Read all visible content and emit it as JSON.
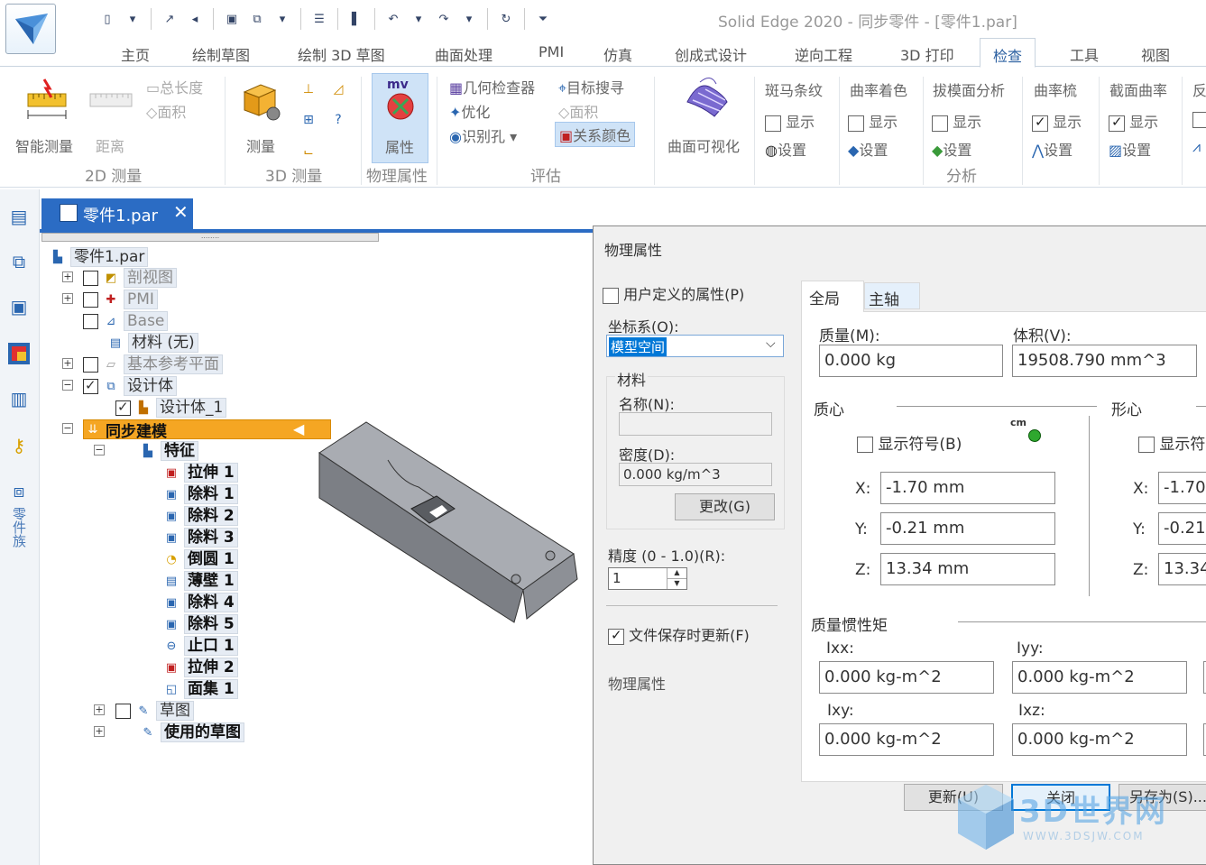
{
  "window": {
    "title": "Solid Edge 2020 - 同步零件 - [零件1.par]"
  },
  "ribbon_tabs": [
    "主页",
    "绘制草图",
    "绘制 3D 草图",
    "曲面处理",
    "PMI",
    "仿真",
    "创成式设计",
    "逆向工程",
    "3D 打印",
    "检查",
    "工具",
    "视图"
  ],
  "active_tab": "检查",
  "ribbon": {
    "smart_measure": "智能测量",
    "distance": "距离",
    "total_length": "总长度",
    "area": "面积",
    "group_2d": "2D 测量",
    "measure": "测量",
    "group_3d": "3D 测量",
    "properties": "属性",
    "group_physical": "物理属性",
    "geometry_inspector": "几何检查器",
    "optimize": "优化",
    "identify_holes": "识别孔",
    "target_search": "目标搜寻",
    "area2": "面积",
    "relationship_color": "关系颜色",
    "group_evaluate": "评估",
    "surface_visualization": "曲面可视化",
    "zebra": "斑马条纹",
    "curvature_shading": "曲率着色",
    "draft_analysis": "拔模面分析",
    "curvature_comb": "曲率梳",
    "section_curvature": "截面曲率",
    "next_partial": "反",
    "show": "显示",
    "settings": "设置",
    "group_analysis": "分析"
  },
  "document_tab": {
    "label": "零件1.par"
  },
  "left_strip": {
    "vertical_label": "零件族"
  },
  "tree": {
    "root": "零件1.par",
    "items": {
      "section_view": "剖视图",
      "pmi": "PMI",
      "base": "Base",
      "material": "材料 (无)",
      "base_planes": "基本参考平面",
      "design_body": "设计体",
      "design_body_1": "设计体_1",
      "sync_modeling": "同步建模",
      "features": "特征",
      "extrude1": "拉伸 1",
      "cut1": "除料 1",
      "cut2": "除料 2",
      "cut3": "除料 3",
      "round1": "倒圆 1",
      "thinwall1": "薄壁 1",
      "cut4": "除料 4",
      "cut5": "除料 5",
      "lip1": "止口 1",
      "extrude2": "拉伸 2",
      "faceset1": "面集 1",
      "sketches": "草图",
      "used_sketches": "使用的草图"
    }
  },
  "dialog": {
    "title": "物理属性",
    "user_defined": "用户定义的属性(P)",
    "coord_label": "坐标系(O):",
    "coord_value": "模型空间",
    "material_group": "材料",
    "name_label": "名称(N):",
    "density_label": "密度(D):",
    "density_value": "0.000 kg/m^3",
    "change_button": "更改(G)",
    "precision_label": "精度 (0 - 1.0)(R):",
    "precision_value": "1",
    "update_on_save": "文件保存时更新(F)",
    "physical_props_text": "物理属性",
    "tabs": [
      "全局",
      "主轴"
    ],
    "mass_label": "质量(M):",
    "mass_value": "0.000 kg",
    "volume_label": "体积(V):",
    "volume_value": "19508.790 mm^3",
    "center_of_mass": "质心",
    "centroid": "形心",
    "show_symbol": "显示符号(B)",
    "show_symbol_partial": "显示符",
    "cm_badge": "cm",
    "x_label": "X:",
    "y_label": "Y:",
    "z_label": "Z:",
    "cm_x": "-1.70 mm",
    "cm_y": "-0.21 mm",
    "cm_z": "13.34 mm",
    "ct_x": "-1.70",
    "ct_y": "-0.21",
    "ct_z": "13.34",
    "inertia_label": "质量惯性矩",
    "ixx_label": "Ixx:",
    "iyy_label": "Iyy:",
    "ixy_label": "Ixy:",
    "ixz_label": "Ixz:",
    "ixx_value": "0.000 kg-m^2",
    "iyy_value": "0.000 kg-m^2",
    "ixy_value": "0.000 kg-m^2",
    "ixz_value": "0.000 kg-m^2",
    "update_button": "更新(U)",
    "close_button": "关闭",
    "save_as_button": "另存为(S)..."
  },
  "watermark": {
    "text": "3D世界网",
    "url": "WWW.3DSJW.COM"
  }
}
